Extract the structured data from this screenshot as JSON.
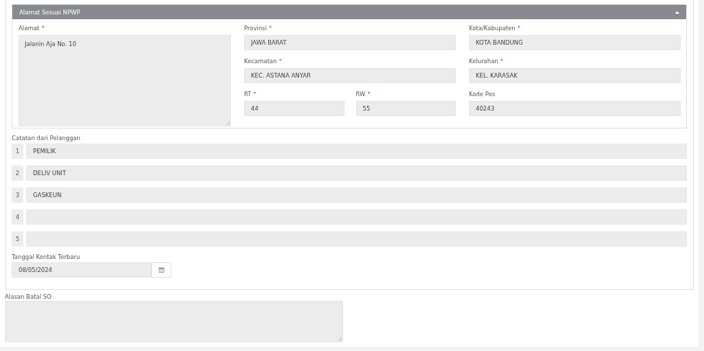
{
  "npwp_panel": {
    "title": "Alamat Sesuai NPWP",
    "expanded": true,
    "alamat": {
      "label": "Alamat",
      "required_mark": "*",
      "value": "Jalanin Aja No. 10"
    },
    "fields": [
      {
        "label": "Provinsi",
        "required_mark": "*",
        "value": "JAWA BARAT"
      },
      {
        "label": "Kota/Kabupaten",
        "required_mark": "*",
        "value": "KOTA BANDUNG"
      },
      {
        "label": "Kecamatan",
        "required_mark": "*",
        "value": "KEC. ASTANA ANYAR"
      },
      {
        "label": "Kelurahan",
        "required_mark": "*",
        "value": "KEL. KARASAK"
      },
      {
        "label": "RT",
        "required_mark": "*",
        "value": "44"
      },
      {
        "label": "RW",
        "required_mark": "*",
        "value": "55"
      },
      {
        "label": "Kode Pos",
        "value": "40243"
      }
    ]
  },
  "notes": {
    "label": "Catatan dari Pelanggan",
    "items": [
      {
        "number": "1",
        "value": "PEMILIK"
      },
      {
        "number": "2",
        "value": "DELIV UNIT"
      },
      {
        "number": "3",
        "value": "GASKEUN"
      },
      {
        "number": "4"
      },
      {
        "number": "5"
      }
    ]
  },
  "last_contact": {
    "label": "Tanggal Kontak Terbaru",
    "value": "08/05/2024"
  },
  "cancel_reason": {
    "label": "Alasan Batal SO"
  }
}
